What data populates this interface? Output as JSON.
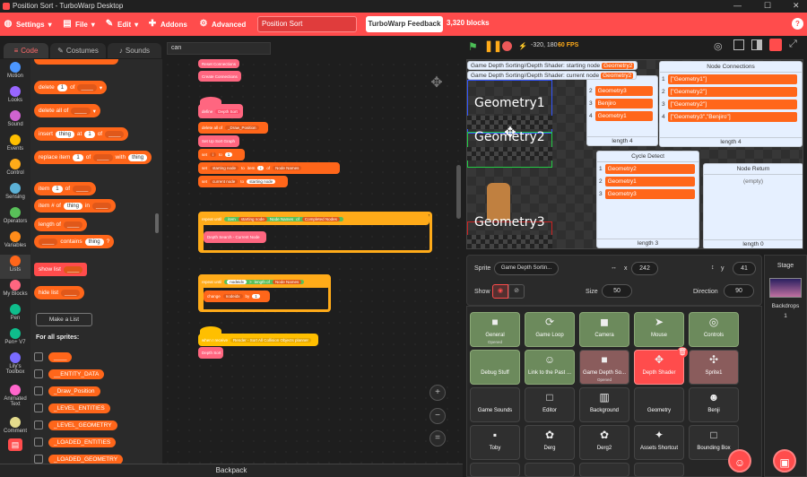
{
  "window": {
    "title": "Position Sort - TurboWarp Desktop",
    "minimize": "—",
    "maximize": "☐",
    "close": "✕"
  },
  "menu": {
    "settings": "Settings",
    "file": "File",
    "edit": "Edit",
    "addons": "Addons",
    "advanced": "Advanced",
    "project_title": "Position Sort",
    "feedback": "TurboWarp Feedback",
    "block_count": "3,320 blocks",
    "help": "?"
  },
  "tabs": {
    "code": "Code",
    "costumes": "Costumes",
    "sounds": "Sounds"
  },
  "search": {
    "value": "can"
  },
  "categories": [
    {
      "label": "Motion",
      "color": "#4c97ff"
    },
    {
      "label": "Looks",
      "color": "#9966ff"
    },
    {
      "label": "Sound",
      "color": "#cf63cf"
    },
    {
      "label": "Events",
      "color": "#ffbf00"
    },
    {
      "label": "Control",
      "color": "#ffab19"
    },
    {
      "label": "Sensing",
      "color": "#5cb1d6"
    },
    {
      "label": "Operators",
      "color": "#59c059"
    },
    {
      "label": "Variables",
      "color": "#ff8c1a"
    },
    {
      "label": "Lists",
      "color": "#ff661a"
    },
    {
      "label": "My Blocks",
      "color": "#ff6680"
    },
    {
      "label": "Pen",
      "color": "#0fbd8c"
    },
    {
      "label": "Pen+ V7",
      "color": "#0fbd8c"
    },
    {
      "label": "Lily's Toolbox",
      "color": "#7a6cff"
    },
    {
      "label": "Animated Text",
      "color": "#ff66cc"
    },
    {
      "label": "Comment",
      "color": "#e4db8c"
    }
  ],
  "palette": {
    "delete": {
      "a": "delete",
      "n": "1",
      "b": "of",
      "list": "____"
    },
    "delete_all": {
      "a": "delete all of",
      "list": "____"
    },
    "insert": {
      "a": "insert",
      "thing": "thing",
      "b": "at",
      "n": "1",
      "c": "of",
      "list": "____"
    },
    "replace": {
      "a": "replace item",
      "n": "1",
      "b": "of",
      "list": "____",
      "c": "with",
      "thing": "thing"
    },
    "item": {
      "a": "item",
      "n": "1",
      "b": "of",
      "list": "____"
    },
    "item_num": {
      "a": "item # of",
      "thing": "thing",
      "b": "in",
      "list": "____"
    },
    "length": {
      "a": "length of",
      "list": "____"
    },
    "contains": {
      "list": "____",
      "a": "contains",
      "thing": "thing",
      "q": "?"
    },
    "show_list": {
      "a": "show list",
      "list": "____"
    },
    "hide_list": {
      "a": "hide list",
      "list": "____"
    },
    "make_list": "Make a List",
    "for_all": "For all sprites:",
    "vars": [
      "____",
      "__ENTITY_DATA",
      "_Draw_Position",
      "_LEVEL_ENTITIES",
      "_LEVEL_GEOMETRY",
      "_LOADED_ENTITIES",
      "_LOADED_GEOMETRY"
    ]
  },
  "workspace": {
    "reset_connections": "Reset Connections",
    "create_connections": "Create Connections",
    "define": "define",
    "depth_sort": "Depth Sort",
    "delete_all_of": "delete all of",
    "draw_position": "_Draw_Position",
    "setup_sort_graph": "Set Up Sort Graph",
    "set": "set",
    "i": "i",
    "to": "to",
    "one": "1",
    "starting_node": "starting node",
    "item": "item",
    "node_names": "Node Names",
    "current_node": "current node",
    "starting_node2": "starting node",
    "repeat_until": "repeat until",
    "of": "of",
    "completed_nodes": "Completed Nodes",
    "depth_search": "Depth Search - Current Node",
    "nodeidx": "nodeidx",
    "gt": ">",
    "length_of": "length of",
    "change": "change",
    "by": "by",
    "when_receive": "when I receive",
    "render_msg": "Render - Sort All Collision Objects planner",
    "depth_sort2": "Depth Sort",
    "zoom_in": "+",
    "zoom_out": "−",
    "zoom_reset": "="
  },
  "backpack": "Backpack",
  "stage_controls": {
    "coords": "-320, 180",
    "fps": "60 FPS"
  },
  "stage": {
    "labels": [
      "Geometry1",
      "Geometry2",
      "Geometry3"
    ],
    "var_monitors": [
      {
        "label": "Game Depth Sorting//Depth Shader: starting node",
        "value": "Geometry2"
      },
      {
        "label": "Game Depth Sorting//Depth Shader: current node",
        "value": "Geometry2"
      }
    ],
    "node_names_list": {
      "items": [
        "Geometry3",
        "Benjiro",
        "Geometry1"
      ],
      "footer": "length 4"
    },
    "node_connections": {
      "title": "Node Connections",
      "items": [
        "[\"Geometry1\"]",
        "[\"Geometry2\"]",
        "[\"Geometry2\"]",
        "[\"Geometry3\",\"Benjiro\"]"
      ],
      "footer": "length 4"
    },
    "cycle_detect": {
      "title": "Cycle Detect",
      "items": [
        "Geometry2",
        "Geometry1",
        "Geometry3"
      ],
      "footer": "length 3"
    },
    "node_return": {
      "title": "Node Return",
      "empty": "(empty)",
      "footer": "length 0"
    }
  },
  "sprite_info": {
    "sprite_label": "Sprite",
    "sprite_name": "Game Depth Sortin...",
    "x_label": "x",
    "x": "242",
    "y_label": "y",
    "y": "41",
    "show_label": "Show",
    "size_label": "Size",
    "size": "50",
    "direction_label": "Direction",
    "direction": "90"
  },
  "sprites": [
    {
      "name": "General",
      "sub": "Opened",
      "icon": "folder-icon",
      "glyph": "■",
      "style": "green"
    },
    {
      "name": "Game Loop",
      "sub": "",
      "icon": "loop-icon",
      "glyph": "⟳",
      "style": "green"
    },
    {
      "name": "Camera",
      "sub": "",
      "icon": "camera-icon",
      "glyph": "◼",
      "style": "green"
    },
    {
      "name": "Mouse",
      "sub": "",
      "icon": "cursor-icon",
      "glyph": "➤",
      "style": "green"
    },
    {
      "name": "Controls",
      "sub": "",
      "icon": "gamepad-icon",
      "glyph": "◎",
      "style": "green"
    },
    {
      "name": "Debug Stuff",
      "sub": "",
      "icon": "debug-icon",
      "glyph": "",
      "style": "green"
    },
    {
      "name": "Link to the Past ...",
      "sub": "",
      "icon": "character-icon",
      "glyph": "☺",
      "style": "green"
    },
    {
      "name": "Game Depth So...",
      "sub": "Opened",
      "icon": "folder-icon",
      "glyph": "■",
      "style": "pinkish"
    },
    {
      "name": "Depth Shader",
      "sub": "",
      "icon": "shader-icon",
      "glyph": "✥",
      "style": "sel"
    },
    {
      "name": "Sprite1",
      "sub": "",
      "icon": "sprite-icon",
      "glyph": "✣",
      "style": "pinkish"
    },
    {
      "name": "Game Sounds",
      "sub": "",
      "icon": "sound-icon",
      "glyph": "",
      "style": ""
    },
    {
      "name": "Editor",
      "sub": "",
      "icon": "editor-icon",
      "glyph": "□",
      "style": ""
    },
    {
      "name": "Background",
      "sub": "",
      "icon": "background-icon",
      "glyph": "▥",
      "style": ""
    },
    {
      "name": "Geometry",
      "sub": "",
      "icon": "geometry-icon",
      "glyph": "",
      "style": ""
    },
    {
      "name": "Benji",
      "sub": "",
      "icon": "benji-icon",
      "glyph": "☻",
      "style": ""
    },
    {
      "name": "Toby",
      "sub": "",
      "icon": "toby-icon",
      "glyph": "▪",
      "style": ""
    },
    {
      "name": "Derg",
      "sub": "",
      "icon": "derg-icon",
      "glyph": "✿",
      "style": ""
    },
    {
      "name": "Derg2",
      "sub": "",
      "icon": "derg-icon",
      "glyph": "✿",
      "style": ""
    },
    {
      "name": "Assets Shortcut",
      "sub": "",
      "icon": "assets-icon",
      "glyph": "✦",
      "style": ""
    },
    {
      "name": "Bounding Box",
      "sub": "",
      "icon": "box-icon",
      "glyph": "□",
      "style": ""
    }
  ],
  "stage_panel": {
    "title": "Stage",
    "backdrops_label": "Backdrops",
    "backdrops": "1"
  },
  "colors": {
    "accent": "#ff4c4c",
    "lists": "#ff661a",
    "myblocks": "#ff6680",
    "control": "#ffab19",
    "events": "#ffbf00"
  }
}
